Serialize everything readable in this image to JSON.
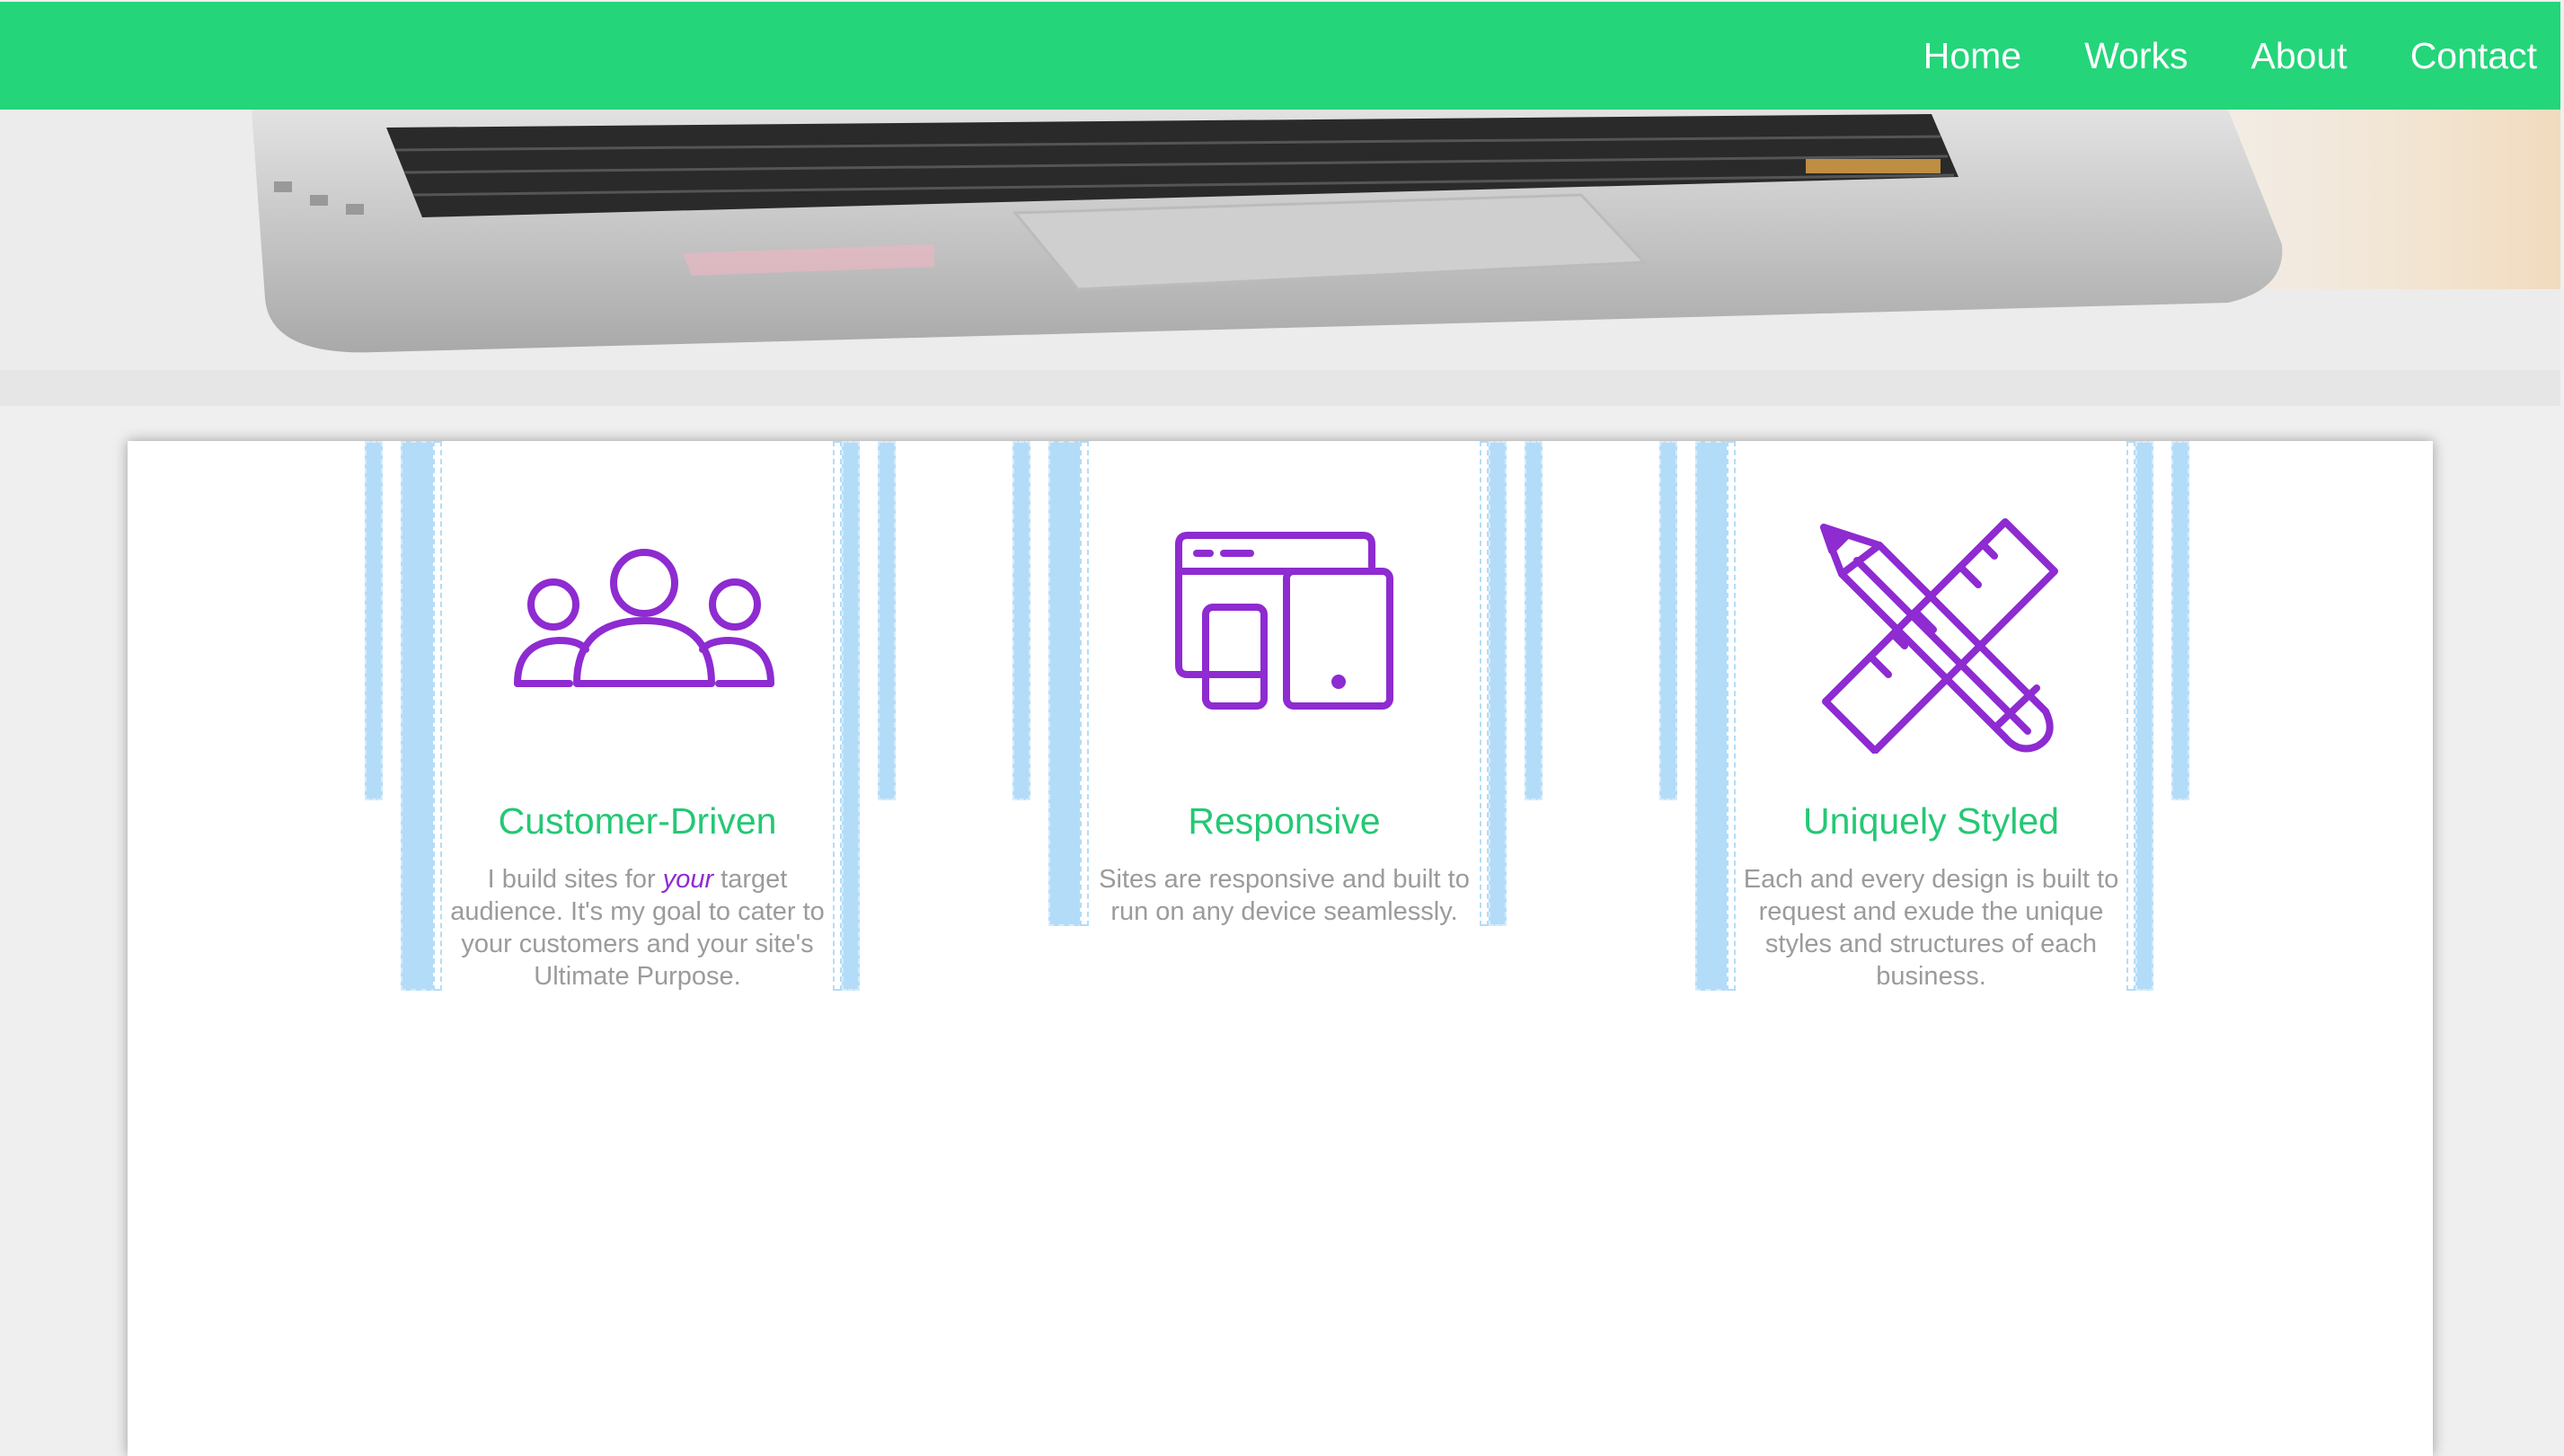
{
  "nav": {
    "items": [
      {
        "label": "Home"
      },
      {
        "label": "Works"
      },
      {
        "label": "About"
      },
      {
        "label": "Contact"
      }
    ]
  },
  "colors": {
    "nav_background": "#24d57a",
    "accent_green": "#24c874",
    "icon_purple": "#8e2bd1",
    "body_text": "#9b9b9b"
  },
  "hero": {
    "icon": "laptop-photo"
  },
  "features": [
    {
      "icon": "customers-group-icon",
      "title": "Customer-Driven",
      "text_before": "I build sites for ",
      "text_emphasis": "your",
      "text_after": " target audience. It's my goal to cater to your customers and your site's Ultimate Purpose."
    },
    {
      "icon": "responsive-devices-icon",
      "title": "Responsive",
      "text": "Sites are responsive and built to run on any device seamlessly."
    },
    {
      "icon": "pencil-ruler-icon",
      "title": "Uniquely Styled",
      "text": "Each and every design is built to request and exude the unique styles and structures of each business."
    }
  ]
}
